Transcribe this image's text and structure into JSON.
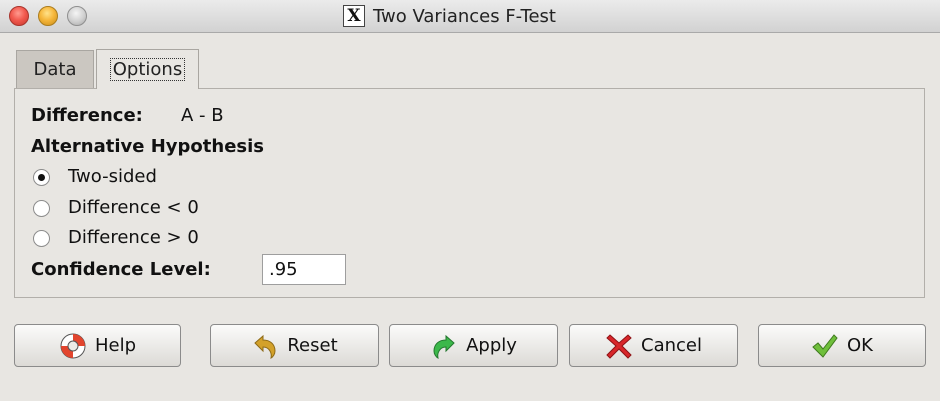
{
  "window": {
    "title": "Two Variances F-Test"
  },
  "tabs": [
    {
      "label": "Data"
    },
    {
      "label": "Options"
    }
  ],
  "options": {
    "difference_label": "Difference:",
    "difference_value": "A - B",
    "alt_hypothesis_label": "Alternative Hypothesis",
    "radio_options": [
      {
        "label": "Two-sided",
        "selected": true
      },
      {
        "label": "Difference < 0",
        "selected": false
      },
      {
        "label": "Difference > 0",
        "selected": false
      }
    ],
    "confidence_label": "Confidence Level:",
    "confidence_value": ".95"
  },
  "buttons": {
    "help": "Help",
    "reset": "Reset",
    "apply": "Apply",
    "cancel": "Cancel",
    "ok": "OK"
  },
  "icons": {
    "window": "x11-icon",
    "help": "lifebuoy-icon",
    "reset": "undo-arrow-icon",
    "apply": "redo-arrow-icon",
    "cancel": "red-x-icon",
    "ok": "checkmark-icon"
  },
  "colors": {
    "close_button": "#f25a4f",
    "minimize_button": "#f6b73c",
    "zoom_button": "#cfcfcf",
    "apply_arrow": "#3cb84a",
    "reset_arrow": "#d3a12a",
    "cancel_x": "#d8262a",
    "ok_check": "#4d9a2a"
  }
}
